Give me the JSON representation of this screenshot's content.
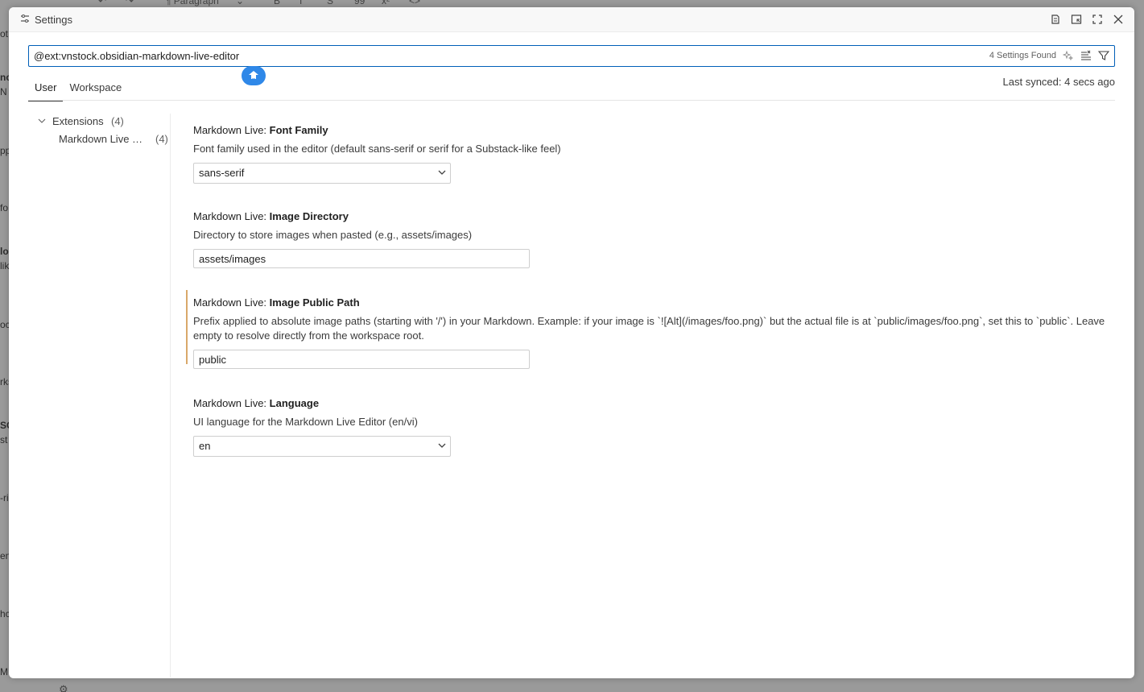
{
  "background": {
    "toolbar_items": [
      "↶",
      "↷",
      "¶ Paragraph",
      "⌄",
      "B",
      "I",
      "S",
      "99",
      "x²",
      "<>",
      "≡",
      "≡",
      "≡",
      "🔗",
      "()",
      "▣",
      "⊞",
      "▤"
    ],
    "left_fragments": [
      "ot",
      "nc",
      "N",
      "pp",
      "fo",
      "lo",
      "lik",
      "oc",
      "rks",
      "SC",
      "st",
      "-ri",
      "en",
      "hc",
      "ME"
    ]
  },
  "dialog": {
    "title": "Settings",
    "title_icon": "settings-sliders-icon",
    "actions": [
      "open-json-icon",
      "split-icon",
      "maximize-icon",
      "close-icon"
    ]
  },
  "search": {
    "value": "@ext:vnstock.obsidian-markdown-live-editor",
    "placeholder": "Search settings",
    "count": "4 Settings Found",
    "actions": [
      "sparkle-icon",
      "clear-filter-icon",
      "filter-icon"
    ]
  },
  "tabs": [
    "User",
    "Workspace"
  ],
  "active_tab": "User",
  "last_synced": "Last synced: 4 secs ago",
  "toc": {
    "group_label": "Extensions",
    "group_count": "(4)",
    "item_label": "Markdown Live Editor",
    "item_count": "(4)"
  },
  "settings": [
    {
      "category": "Markdown Live: ",
      "name": "Font Family",
      "description": "Font family used in the editor (default sans-serif or serif for a Substack-like feel)",
      "control": "select",
      "value": "sans-serif"
    },
    {
      "category": "Markdown Live: ",
      "name": "Image Directory",
      "description": "Directory to store images when pasted (e.g., assets/images)",
      "control": "text",
      "value": "assets/images"
    },
    {
      "category": "Markdown Live: ",
      "name": "Image Public Path",
      "description": "Prefix applied to absolute image paths (starting with '/') in your Markdown. Example: if your image is `![Alt](/images/foo.png)` but the actual file is at `public/images/foo.png`, set this to `public`. Leave empty to resolve directly from the workspace root.",
      "control": "text",
      "value": "public",
      "modified": true
    },
    {
      "category": "Markdown Live: ",
      "name": "Language",
      "description": "UI language for the Markdown Live Editor (en/vi)",
      "control": "select",
      "value": "en"
    }
  ],
  "colors": {
    "accent": "#005fb8",
    "modified_indicator": "#d9a86a",
    "badge": "#2f88e8"
  }
}
